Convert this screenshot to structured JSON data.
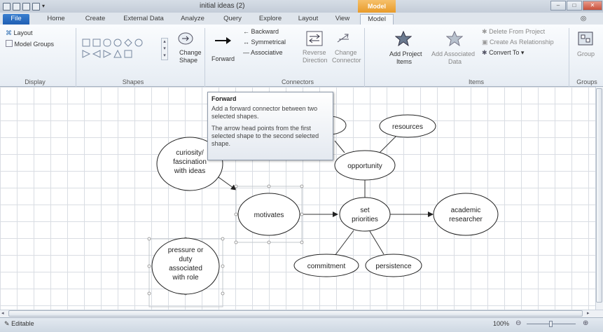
{
  "window": {
    "title": "initial ideas (2)",
    "context_tab": "Model"
  },
  "tabs": [
    {
      "label": "File"
    },
    {
      "label": "Home"
    },
    {
      "label": "Create"
    },
    {
      "label": "External Data"
    },
    {
      "label": "Analyze"
    },
    {
      "label": "Query"
    },
    {
      "label": "Explore"
    },
    {
      "label": "Layout"
    },
    {
      "label": "View"
    },
    {
      "label": "Model"
    }
  ],
  "ribbon": {
    "display": {
      "layout": "Layout",
      "model_groups": "Model Groups",
      "label": "Display"
    },
    "shapes": {
      "change_shape": "Change",
      "change_shape2": "Shape",
      "label": "Shapes"
    },
    "connectors": {
      "forward": "Forward",
      "backward": "Backward",
      "symmetrical": "Symmetrical",
      "associative": "Associative",
      "reverse": "Reverse",
      "reverse2": "Direction",
      "change": "Change",
      "change2": "Connector",
      "label": "Connectors"
    },
    "items": {
      "add_project": "Add Project",
      "add_project2": "Items",
      "add_assoc": "Add Associated",
      "add_assoc2": "Data",
      "delete": "Delete From Project",
      "create_rel": "Create As Relationship",
      "convert": "Convert To",
      "label": "Items"
    },
    "groups": {
      "group": "Group",
      "label": "Groups"
    }
  },
  "tooltip": {
    "title": "Forward",
    "line1": "Add a forward connector between two selected shapes.",
    "line2": "The arrow head points from the first selected shape to the second selected shape."
  },
  "diagram": {
    "nodes": {
      "curiosity": [
        "curiosity/",
        "fascination",
        "with ideas"
      ],
      "motivates": [
        "motivates"
      ],
      "pressure": [
        "pressure or",
        "duty",
        "associated",
        "with role"
      ],
      "set_priorities": [
        "set",
        "priorities"
      ],
      "academic": [
        "academic",
        "researcher"
      ],
      "opportunity": [
        "opportunity"
      ],
      "resources": [
        "resources"
      ],
      "commitment": [
        "commitment"
      ],
      "persistence": [
        "persistence"
      ]
    }
  },
  "status": {
    "mode": "Editable",
    "zoom": "100%"
  }
}
